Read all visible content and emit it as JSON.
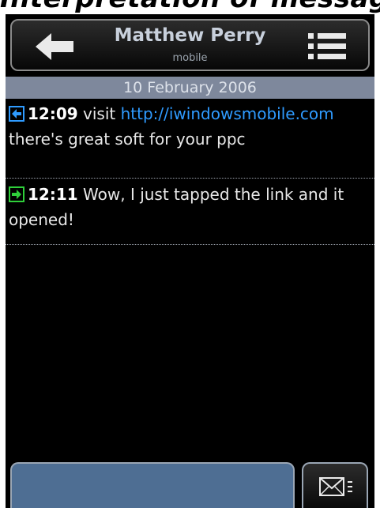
{
  "page_heading": "Interpretation of messages",
  "header": {
    "contact_name": "Matthew Perry",
    "contact_type": "mobile",
    "back_icon": "back-arrow-icon",
    "menu_icon": "menu-list-icon"
  },
  "date_bar": {
    "label": "10 February 2006"
  },
  "messages": [
    {
      "direction": "incoming",
      "icon": "incoming-arrow-icon",
      "icon_color": "#2f9bff",
      "time": "12:09",
      "text_before": "visit",
      "link": "http://iwindowsmobile.com",
      "text_after": "there's great soft for your ppc"
    },
    {
      "direction": "outgoing",
      "icon": "outgoing-arrow-icon",
      "icon_color": "#2fcf3a",
      "time": "12:11",
      "text": "Wow, I just tapped the link and it opened!"
    }
  ],
  "composer": {
    "input_value": "",
    "send_icon": "envelope-icon",
    "send_menu_icon": "menu-list-icon"
  },
  "colors": {
    "screen_bg": "#000000",
    "date_bar_bg": "#7e889c",
    "input_bg": "#4e6e93",
    "link": "#2f9bff"
  }
}
